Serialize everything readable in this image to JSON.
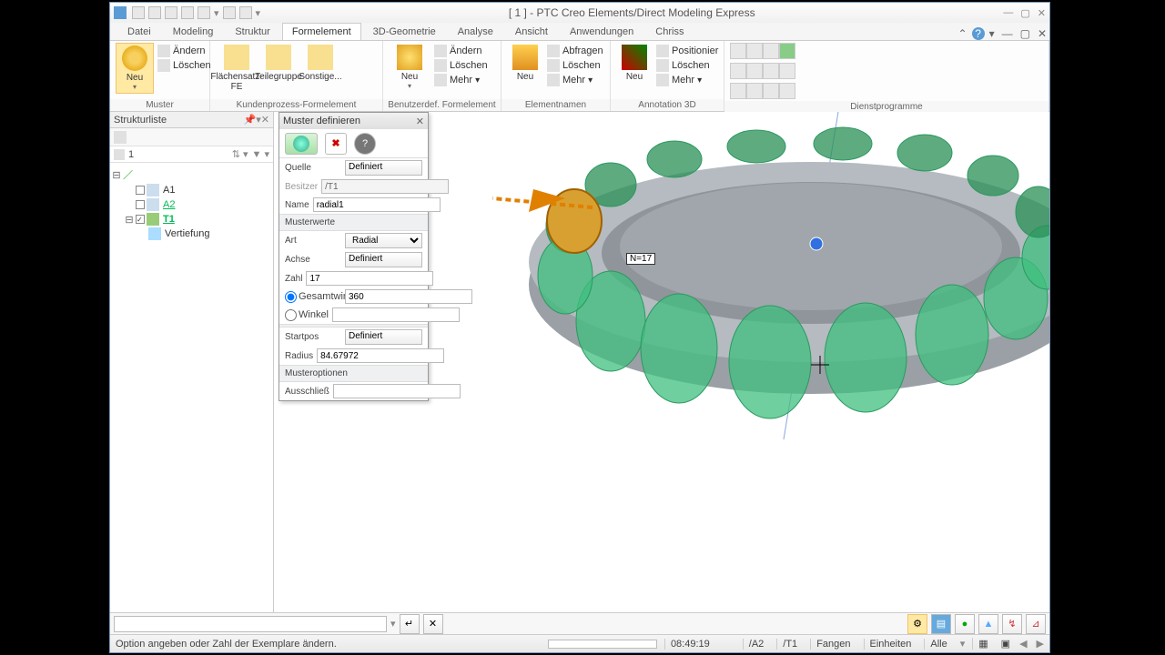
{
  "app": {
    "title": "[ 1 ] - PTC Creo Elements/Direct Modeling Express"
  },
  "tabs": {
    "items": [
      "Datei",
      "Modeling",
      "Struktur",
      "Formelement",
      "3D-Geometrie",
      "Analyse",
      "Ansicht",
      "Anwendungen",
      "Chriss"
    ],
    "active": 3
  },
  "ribbon": {
    "groups": {
      "g0": {
        "label": "Muster",
        "big_neu": "Neu",
        "aendern": "Ändern",
        "loeschen": "Löschen"
      },
      "g1": {
        "label": "Kundenprozess-Formelement",
        "b0": "Flächensatz-FE",
        "b1": "Teilegruppe",
        "b2": "Sonstige..."
      },
      "g2": {
        "label": "Benutzerdef. Formelement",
        "big_neu": "Neu",
        "aendern": "Ändern",
        "loeschen": "Löschen",
        "mehr": "Mehr"
      },
      "g3": {
        "label": "Elementnamen",
        "big_neu": "Neu",
        "abfragen": "Abfragen",
        "loeschen": "Löschen",
        "mehr": "Mehr"
      },
      "g4": {
        "label": "Annotation 3D",
        "big_neu": "Neu",
        "positionier": "Positionier",
        "loeschen": "Löschen",
        "mehr": "Mehr"
      },
      "g5": {
        "label": "Dienstprogramme"
      }
    }
  },
  "sidepanel": {
    "title": "Strukturliste",
    "filter_count": "1",
    "nodes": {
      "a1": "A1",
      "a2": "A2",
      "t1": "T1",
      "vertiefung": "Vertiefung"
    }
  },
  "dialog": {
    "title": "Muster definieren",
    "quelle_label": "Quelle",
    "quelle_btn": "Definiert",
    "besitzer_label": "Besitzer",
    "besitzer_val": "/T1",
    "name_label": "Name",
    "name_val": "radial1",
    "musterwerte": "Musterwerte",
    "art_label": "Art",
    "art_val": "Radial",
    "achse_label": "Achse",
    "achse_btn": "Definiert",
    "zahl_label": "Zahl",
    "zahl_val": "17",
    "gesamtwink_label": "Gesamtwink",
    "gesamtwink_val": "360",
    "winkel_label": "Winkel",
    "startpos_label": "Startpos",
    "startpos_btn": "Definiert",
    "radius_label": "Radius",
    "radius_val": "84.67972",
    "musteroptionen": "Musteroptionen",
    "ausschliess_label": "Ausschließ"
  },
  "viewport": {
    "annotation": "N=17"
  },
  "status": {
    "msg": "Option angeben oder Zahl der Exemplare ändern.",
    "time": "08:49:19",
    "path1": "/A2",
    "path2": "/T1",
    "fangen": "Fangen",
    "einheiten": "Einheiten",
    "alle": "Alle"
  }
}
